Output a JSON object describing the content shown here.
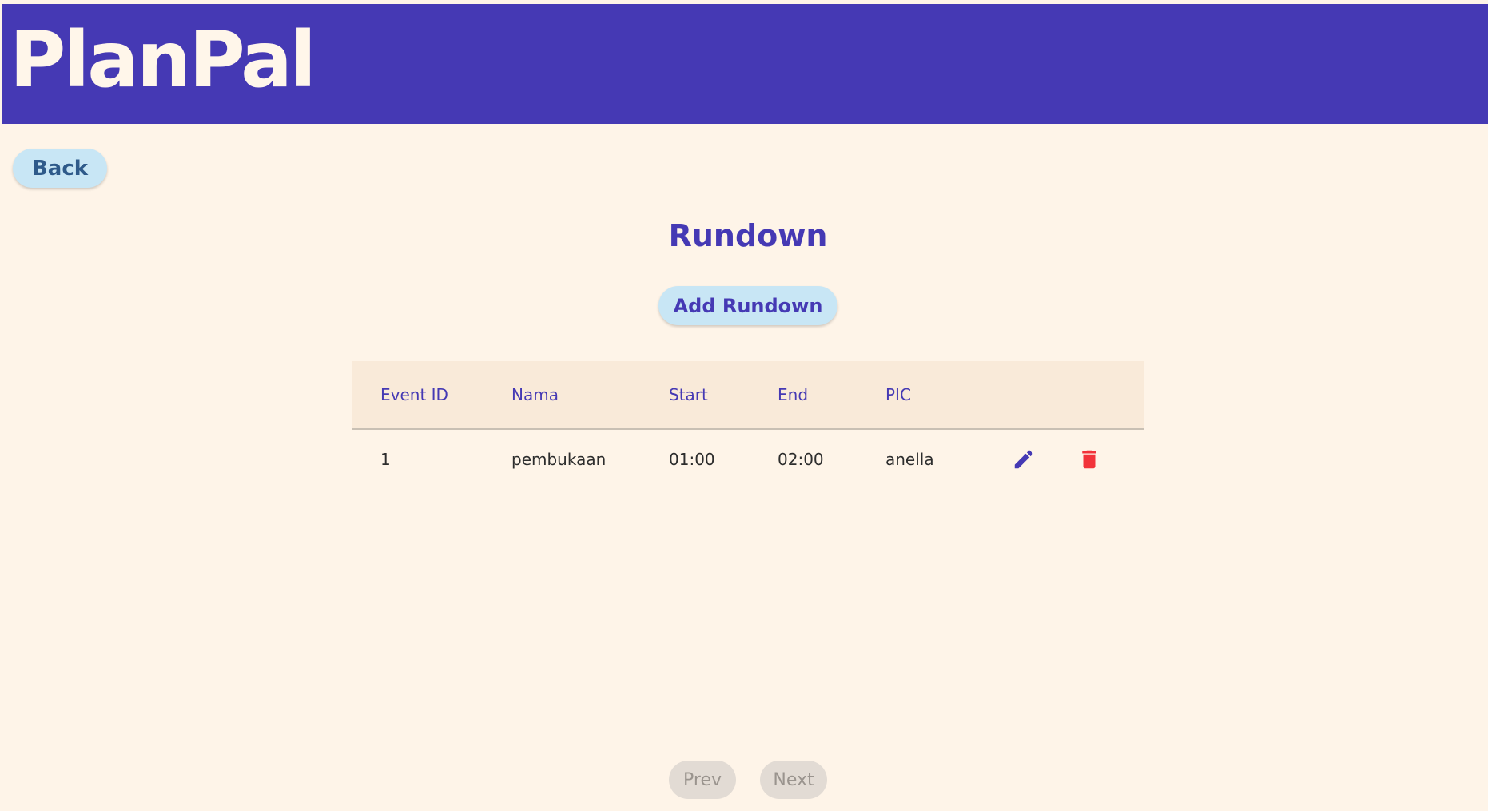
{
  "app": {
    "logo": "PlanPal"
  },
  "nav": {
    "back_label": "Back"
  },
  "page": {
    "title": "Rundown",
    "add_label": "Add Rundown"
  },
  "table": {
    "headers": [
      "Event ID",
      "Nama",
      "Start",
      "End",
      "PIC"
    ],
    "rows": [
      {
        "event_id": "1",
        "nama": "pembukaan",
        "start": "01:00",
        "end": "02:00",
        "pic": "anella",
        "actions": [
          "edit-icon",
          "trash-icon"
        ]
      }
    ]
  },
  "pagination": {
    "prev_label": "Prev",
    "next_label": "Next",
    "prev_enabled": false,
    "next_enabled": false
  },
  "colors": {
    "header_bg": "#4539b4",
    "page_bg": "#fef4e8",
    "button_bg": "#c8e6f5",
    "edit_icon": "#4539b4",
    "delete_icon": "#f2333a",
    "disabled_button": "#e2dbd4"
  }
}
